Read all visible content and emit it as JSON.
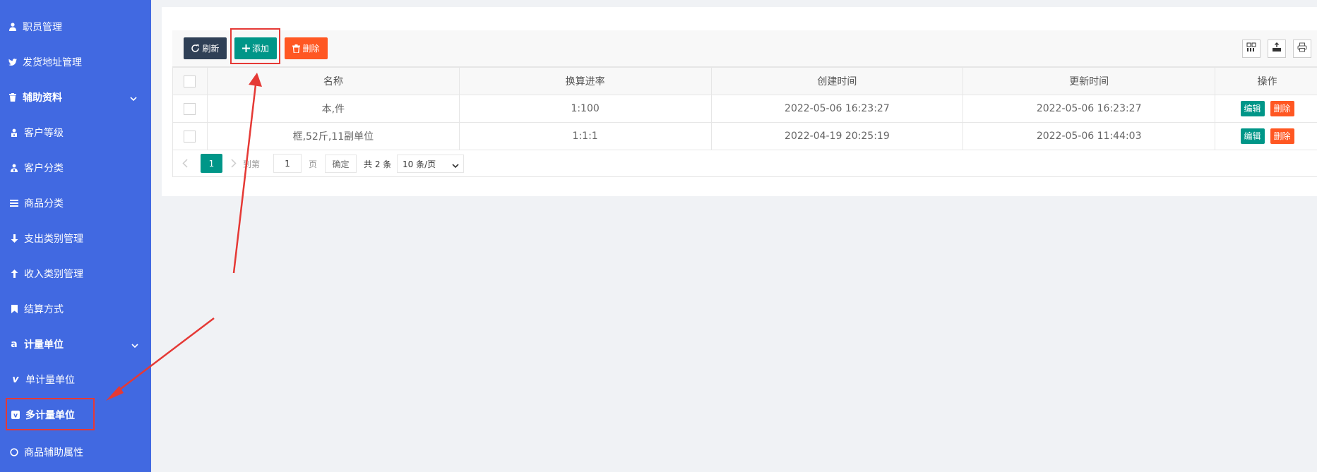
{
  "sidebar": {
    "items": [
      {
        "label": "职员管理",
        "icon": "user-icon"
      },
      {
        "label": "发货地址管理",
        "icon": "twitter-icon"
      },
      {
        "label": "辅助资料",
        "icon": "trash-icon",
        "group": true
      },
      {
        "label": "客户等级",
        "icon": "user-lock-icon"
      },
      {
        "label": "客户分类",
        "icon": "user-group-icon"
      },
      {
        "label": "商品分类",
        "icon": "list-icon"
      },
      {
        "label": "支出类别管理",
        "icon": "arrow-down-icon"
      },
      {
        "label": "收入类别管理",
        "icon": "arrow-up-icon"
      },
      {
        "label": "结算方式",
        "icon": "bookmark-icon"
      },
      {
        "label": "计量单位",
        "icon": "amazon-icon",
        "group": true
      },
      {
        "label": "单计量单位",
        "icon": "vimeo-icon"
      },
      {
        "label": "多计量单位",
        "icon": "vimeo-square-icon",
        "active": true
      },
      {
        "label": "商品辅助属性",
        "icon": "circle-icon"
      }
    ]
  },
  "toolbar": {
    "refresh_label": "刷新",
    "add_label": "添加",
    "delete_label": "删除"
  },
  "table": {
    "headers": [
      "名称",
      "换算进率",
      "创建时间",
      "更新时间",
      "操作"
    ],
    "rows": [
      {
        "name": "本,件",
        "rate": "1:100",
        "created": "2022-05-06 16:23:27",
        "updated": "2022-05-06 16:23:27"
      },
      {
        "name": "框,52斤,11副单位",
        "rate": "1:1:1",
        "created": "2022-04-19 20:25:19",
        "updated": "2022-05-06 11:44:03"
      }
    ],
    "edit_label": "编辑",
    "delete_label": "删除"
  },
  "pager": {
    "current": "1",
    "goto_label": "到第",
    "input_value": "1",
    "page_label": "页",
    "confirm_label": "确定",
    "total_label": "共 2 条",
    "size_label": "10 条/页"
  },
  "colors": {
    "sidebar": "#4169e1",
    "refresh": "#2f4056",
    "primary": "#009688",
    "danger": "#ff5722",
    "annotation": "#e53935"
  }
}
